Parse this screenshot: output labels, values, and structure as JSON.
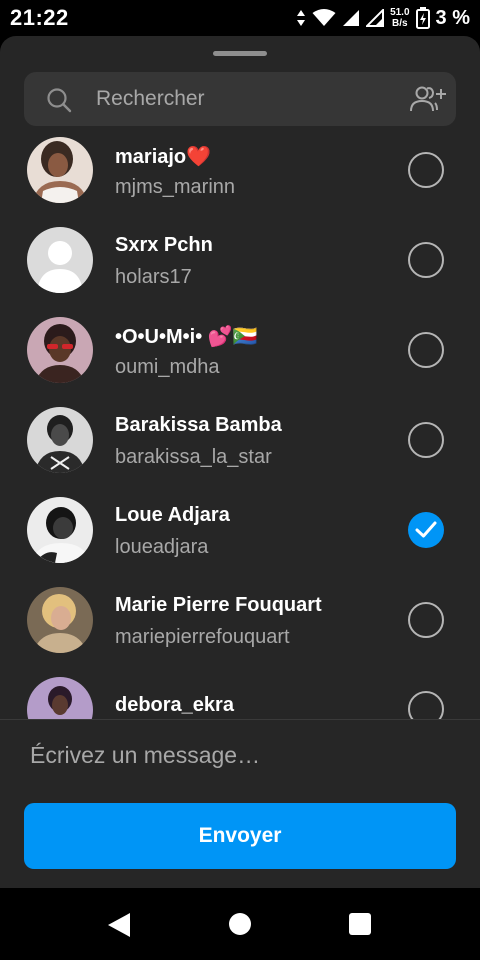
{
  "status_bar": {
    "time": "21:22",
    "speed_value": "51.0",
    "speed_unit": "B/s",
    "battery": "3 %"
  },
  "search": {
    "placeholder": "Rechercher",
    "icon": "search-icon",
    "action_icon": "add-group-icon"
  },
  "contacts": [
    {
      "name": "mariajo❤️",
      "username": "mjms_marinn",
      "selected": false
    },
    {
      "name": "Sxrx Pchn",
      "username": "holars17",
      "selected": false
    },
    {
      "name": "•O•U•M•i• 💕🇰🇲",
      "username": "oumi_mdha",
      "selected": false
    },
    {
      "name": "Barakissa Bamba",
      "username": "barakissa_la_star",
      "selected": false
    },
    {
      "name": "Loue Adjara",
      "username": "loueadjara",
      "selected": true
    },
    {
      "name": "Marie Pierre Fouquart",
      "username": "mariepierrefouquart",
      "selected": false
    },
    {
      "name": "debora_ekra",
      "username": "",
      "selected": false
    }
  ],
  "composer": {
    "placeholder": "Écrivez un message…",
    "send_label": "Envoyer"
  },
  "colors": {
    "accent": "#0095f6",
    "sheet_background": "#262626",
    "search_background": "#363636",
    "secondary_text": "#a8a8a8"
  }
}
